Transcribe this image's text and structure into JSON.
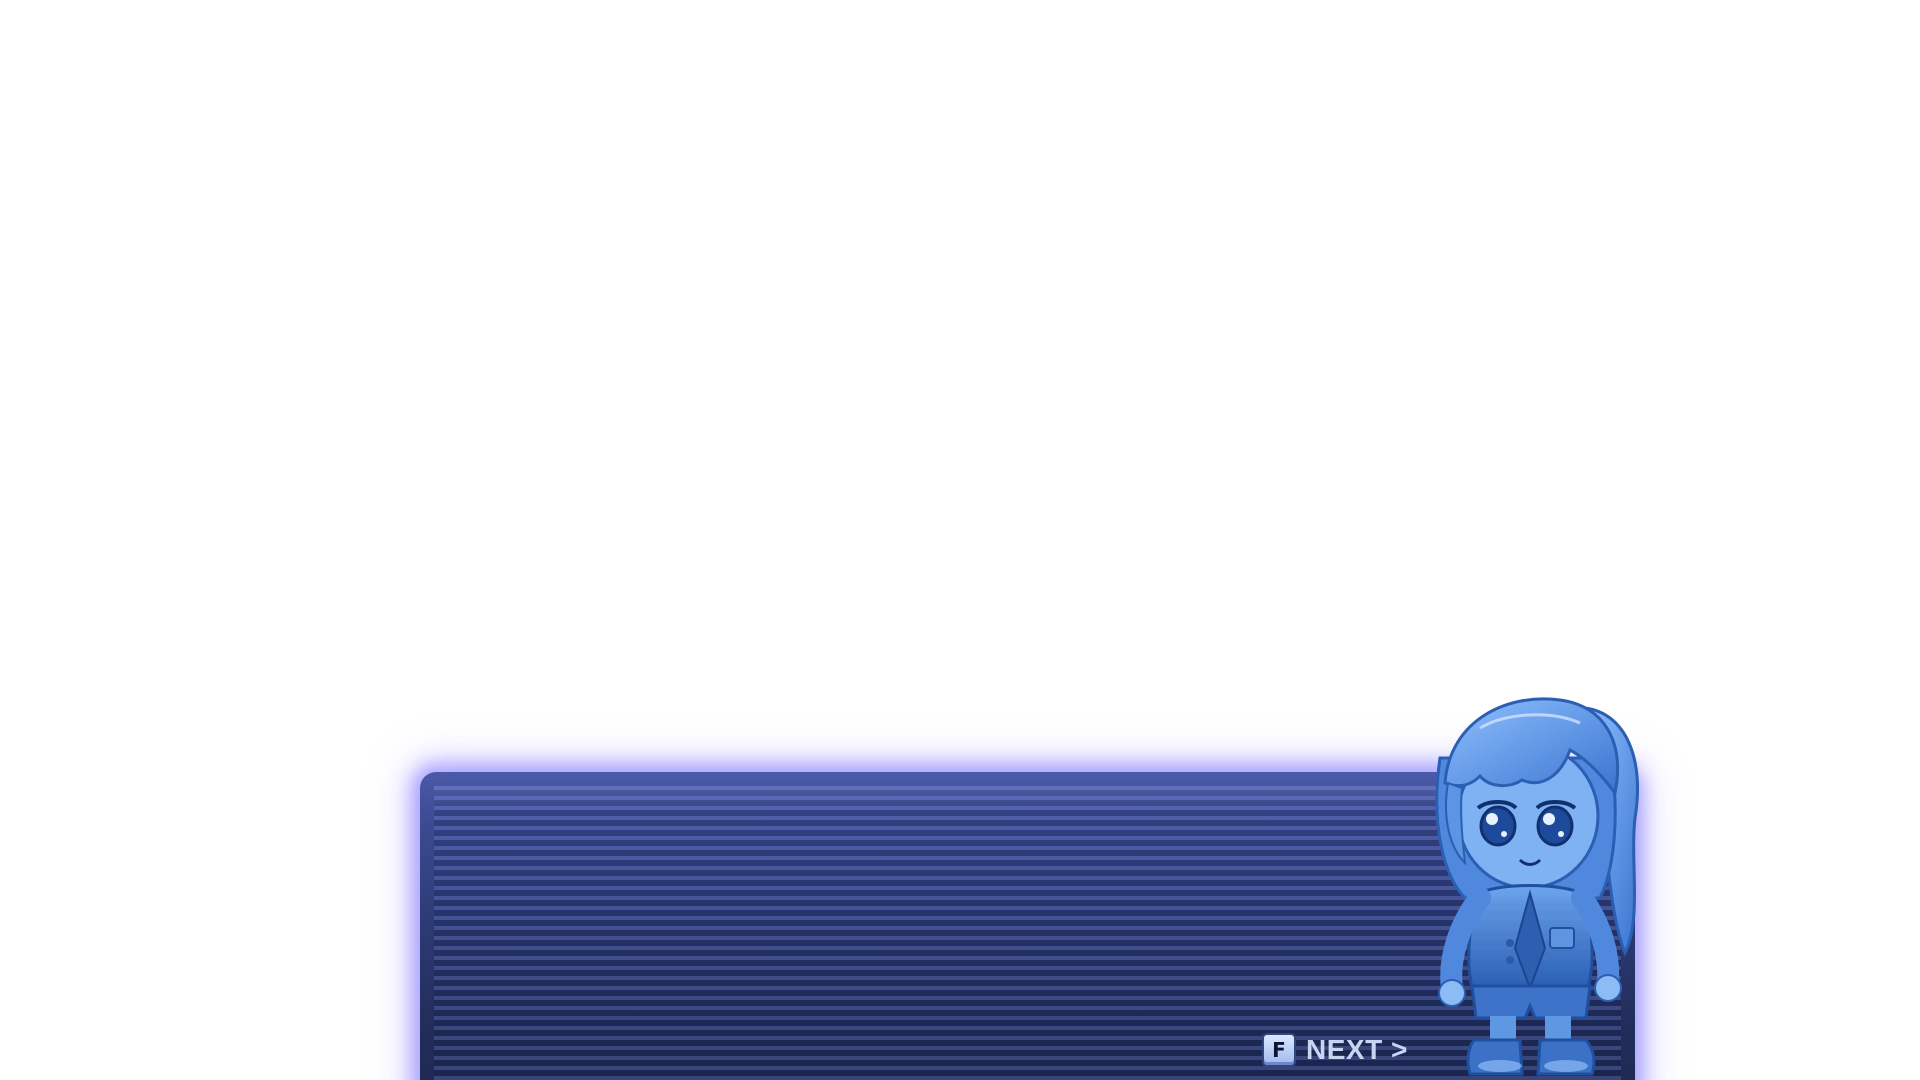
{
  "dialogue": {
    "text": ""
  },
  "next_prompt": {
    "key": "F",
    "label": "NEXT >"
  },
  "character": {
    "icon": "chibi-hologram-girl-portrait"
  },
  "colors": {
    "panel_top": "#4a5aa8",
    "panel_bottom": "#1e2850",
    "panel_glow": "#968cff",
    "hologram_blue": "#3b7bd6",
    "next_text": "#c9d3f2"
  }
}
